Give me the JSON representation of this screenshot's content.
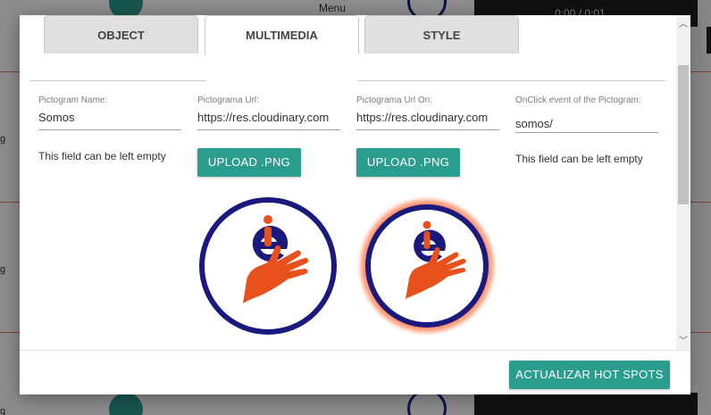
{
  "background": {
    "menu_label": "Menu",
    "side_letters": [
      "g",
      "g",
      "g"
    ],
    "video_time": "0:00 / 0:01"
  },
  "tabs": [
    {
      "label": "OBJECT",
      "active": false
    },
    {
      "label": "MULTIMEDIA",
      "active": true
    },
    {
      "label": "STYLE",
      "active": false
    }
  ],
  "fields": {
    "pictogram_name": {
      "label": "Pictogram Name:",
      "value": "Somos",
      "hint": "This field can be left empty"
    },
    "pictogram_url": {
      "label": "Pictograma Url:",
      "value": "https://res.cloudinary.com",
      "button": "UPLOAD .PNG"
    },
    "pictogram_url_on": {
      "label": "Pictograma Url On:",
      "value": "https://res.cloudinary.com",
      "button": "UPLOAD .PNG"
    },
    "onclick_event": {
      "label": "OnClick event of the Pictogram:",
      "value": "somos/",
      "hint": "This field can be left empty"
    }
  },
  "pictograms": {
    "normal": {
      "icon": "e-hand-logo-icon"
    },
    "hover": {
      "icon": "e-hand-logo-glow-icon"
    }
  },
  "footer": {
    "action_button": "ACTUALIZAR HOT SPOTS"
  },
  "colors": {
    "accent": "#2a9d8f",
    "navy": "#1a1a7e",
    "orange": "#e8501e",
    "glow": "#ff4a1a"
  }
}
